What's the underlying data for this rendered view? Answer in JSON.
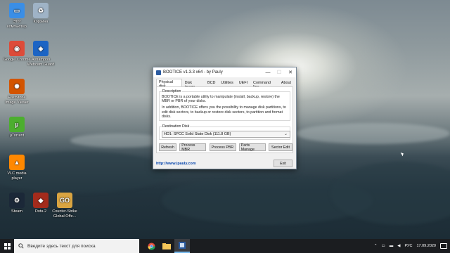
{
  "desktop": {
    "icons": [
      {
        "label": "Этот компьютер",
        "color": "#3a8ee6",
        "glyph": "▭"
      },
      {
        "label": "Корзина",
        "color": "#9fb3c6",
        "glyph": "♻"
      },
      {
        "label": "Google Chrome",
        "color": "#dd4b39",
        "glyph": "◉"
      },
      {
        "label": "Ashampoo Webcam Guard",
        "color": "#1c64c4",
        "glyph": "◈"
      },
      {
        "label": "FastStone Image Viewer",
        "color": "#d35400",
        "glyph": "✺"
      },
      {
        "label": "µTorrent",
        "color": "#4cae2e",
        "glyph": "µ"
      },
      {
        "label": "VLC media player",
        "color": "#ff8800",
        "glyph": "▲"
      },
      {
        "label": "Steam",
        "color": "#1b2838",
        "glyph": "⚙"
      },
      {
        "label": "Dota 2",
        "color": "#a32b1c",
        "glyph": "◆"
      },
      {
        "label": "Counter-Strike Global Offe...",
        "color": "#d9a441",
        "glyph": "GO"
      }
    ]
  },
  "window": {
    "title": "BOOTICE v1.3.3 x64 - by Pauly",
    "tabs": [
      "Physical disk",
      "Disk image",
      "BCD",
      "Utilities",
      "UEFI",
      "Command line",
      "About"
    ],
    "active_tab": "Physical disk",
    "description_label": "Description",
    "description_p1": "BOOTICE is a portable utility to manipulate (install, backup, restore) the MBR or PBR of your disks.",
    "description_p2": "In addition, BOOTICE offers you the possibility to manage disk partitions, to edit disk sectors, to backup or restore disk sectors, to partition and format disks.",
    "destination_label": "Destination Disk",
    "destination_value": "HD1: SPCC Solid State Disk (111.8 GB)",
    "buttons": [
      "Refresh",
      "Process MBR",
      "Process PBR",
      "Parts Manage",
      "Sector Edit"
    ],
    "link": "http://www.ipauly.com",
    "exit_label": "Exit",
    "accent": "#0645ad"
  },
  "taskbar": {
    "search_placeholder": "Введите здесь текст для поиска",
    "pinned": [
      "chrome",
      "file-explorer",
      "bootice"
    ],
    "language": "РУС",
    "time": "",
    "date": "17.09.2020"
  }
}
